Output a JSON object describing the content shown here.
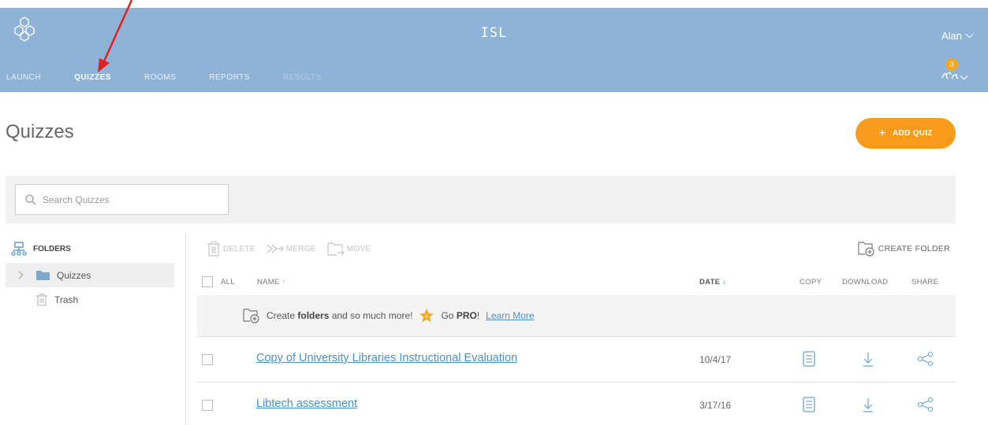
{
  "app": {
    "title": "ISL",
    "user": "Alan",
    "credits": "0"
  },
  "nav": [
    {
      "label": "LAUNCH",
      "state": "normal"
    },
    {
      "label": "QUIZZES",
      "state": "active"
    },
    {
      "label": "ROOMS",
      "state": "normal"
    },
    {
      "label": "REPORTS",
      "state": "normal"
    },
    {
      "label": "RESULTS",
      "state": "disabled"
    }
  ],
  "page": {
    "title": "Quizzes",
    "add_label": "ADD QUIZ"
  },
  "search": {
    "placeholder": "Search Quizzes"
  },
  "sidebar": {
    "header": "FOLDERS",
    "items": [
      {
        "label": "Quizzes",
        "selected": true
      },
      {
        "label": "Trash",
        "selected": false
      }
    ]
  },
  "toolbar": {
    "delete": "DELETE",
    "merge": "MERGE",
    "move": "MOVE",
    "create_folder": "CREATE FOLDER"
  },
  "table": {
    "headers": {
      "all": "ALL",
      "name": "NAME",
      "date": "DATE",
      "copy": "COPY",
      "download": "DOWNLOAD",
      "share": "SHARE"
    },
    "promo": {
      "pre": "Create",
      "bold1": "folders",
      "mid": "and so much more!",
      "go": "Go",
      "bold2": "PRO",
      "bang": "!",
      "link": "Learn More"
    },
    "rows": [
      {
        "name": "Copy of University Libraries Instructional Evaluation",
        "date": "10/4/17"
      },
      {
        "name": "Libtech assessment",
        "date": "3/17/16"
      }
    ]
  },
  "colors": {
    "header_bg": "#8fb3d6",
    "accent_orange": "#f89b1c",
    "link_blue": "#4a90c8",
    "arrow_red": "#e02020"
  },
  "icons": {
    "logo": "hexagon-cluster-icon",
    "copy": "document-copy-icon",
    "download": "download-arrow-icon",
    "share": "share-nodes-icon"
  }
}
